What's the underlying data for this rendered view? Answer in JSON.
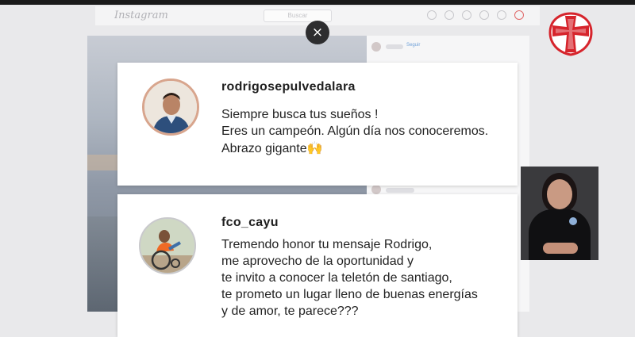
{
  "background": {
    "app_logo": "Instagram",
    "search_placeholder": "Buscar",
    "follow_link": "Seguir"
  },
  "close_button": {
    "icon": "close-icon",
    "glyph": "×"
  },
  "channel_logo": {
    "icon": "channel-logo-icon",
    "color": "#d6242c"
  },
  "comments": [
    {
      "username": "rodrigosepulvedalara",
      "lines": [
        "Siempre busca tus sueños !",
        "Eres un campeón. Algún día nos conoceremos.",
        "Abrazo gigante"
      ],
      "emoji": "🙌"
    },
    {
      "username": "fco_cayu",
      "lines": [
        "Tremendo honor tu mensaje Rodrigo,",
        "me aprovecho de la oportunidad y",
        "te invito a conocer la teletón de santiago,",
        "te prometo un lugar lleno de buenas energías",
        "y de amor, te parece???"
      ]
    }
  ],
  "colors": {
    "card_background": "#ffffff",
    "page_background": "#e9e9eb",
    "avatar_ring": "#d8a58d"
  }
}
